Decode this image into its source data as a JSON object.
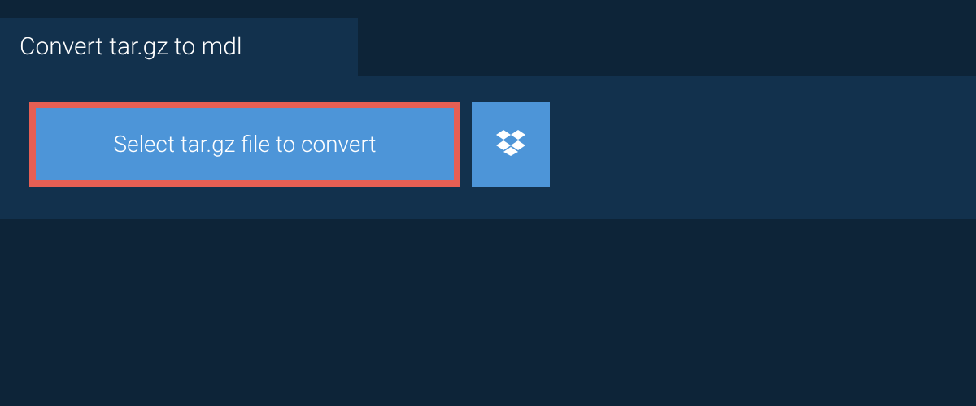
{
  "tab": {
    "title": "Convert tar.gz to mdl"
  },
  "buttons": {
    "select_file_label": "Select tar.gz file to convert"
  },
  "icons": {
    "dropbox": "dropbox-icon"
  },
  "colors": {
    "background": "#0d2438",
    "panel": "#12314d",
    "button_primary": "#4d95d8",
    "button_highlight_border": "#e65f54",
    "text": "#ffffff"
  }
}
